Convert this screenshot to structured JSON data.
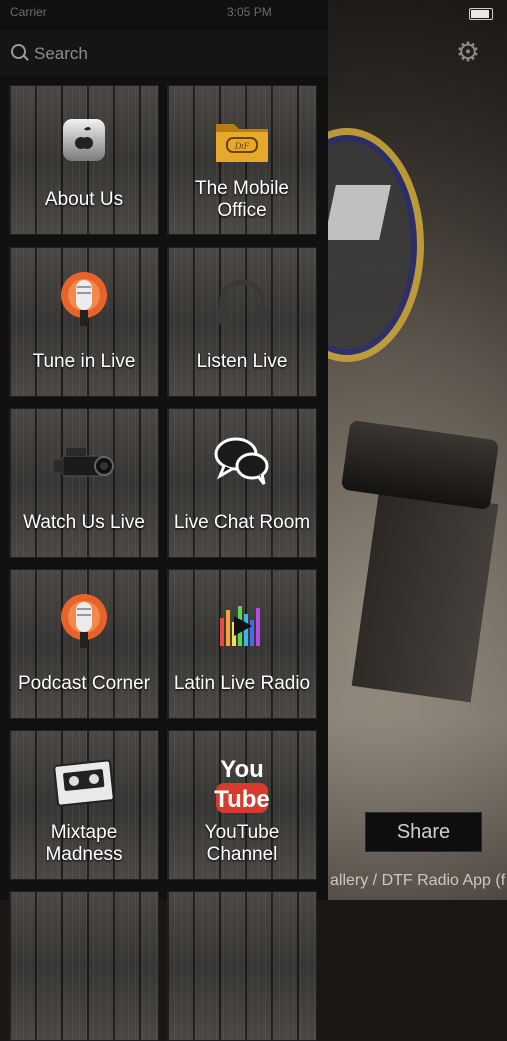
{
  "status_bar": {
    "carrier": "Carrier",
    "time": "3:05 PM"
  },
  "search": {
    "placeholder": "Search"
  },
  "menu": [
    {
      "label": "About Us",
      "icon": "apple-logo-icon"
    },
    {
      "label": "The Mobile\nOffice",
      "icon": "folder-icon"
    },
    {
      "label": "Tune in Live",
      "icon": "podcast-mic-icon"
    },
    {
      "label": "Listen Live",
      "icon": "headphones-icon"
    },
    {
      "label": "Watch Us Live",
      "icon": "video-camera-icon"
    },
    {
      "label": "Live Chat Room",
      "icon": "chat-bubbles-icon"
    },
    {
      "label": "Podcast Corner",
      "icon": "podcast-mic-icon"
    },
    {
      "label": "Latin Live Radio",
      "icon": "equalizer-play-icon"
    },
    {
      "label": "Mixtape\nMadness",
      "icon": "cassette-icon"
    },
    {
      "label": "YouTube\nChannel",
      "icon": "youtube-icon"
    }
  ],
  "share_button": "Share",
  "ticker_text": "allery / DTF Radio App (f",
  "colors": {
    "tile_text": "#ffffff",
    "podcast_orange": "#e8632a",
    "folder_gold": "#e0a42a",
    "youtube_red": "#d63b2f"
  }
}
